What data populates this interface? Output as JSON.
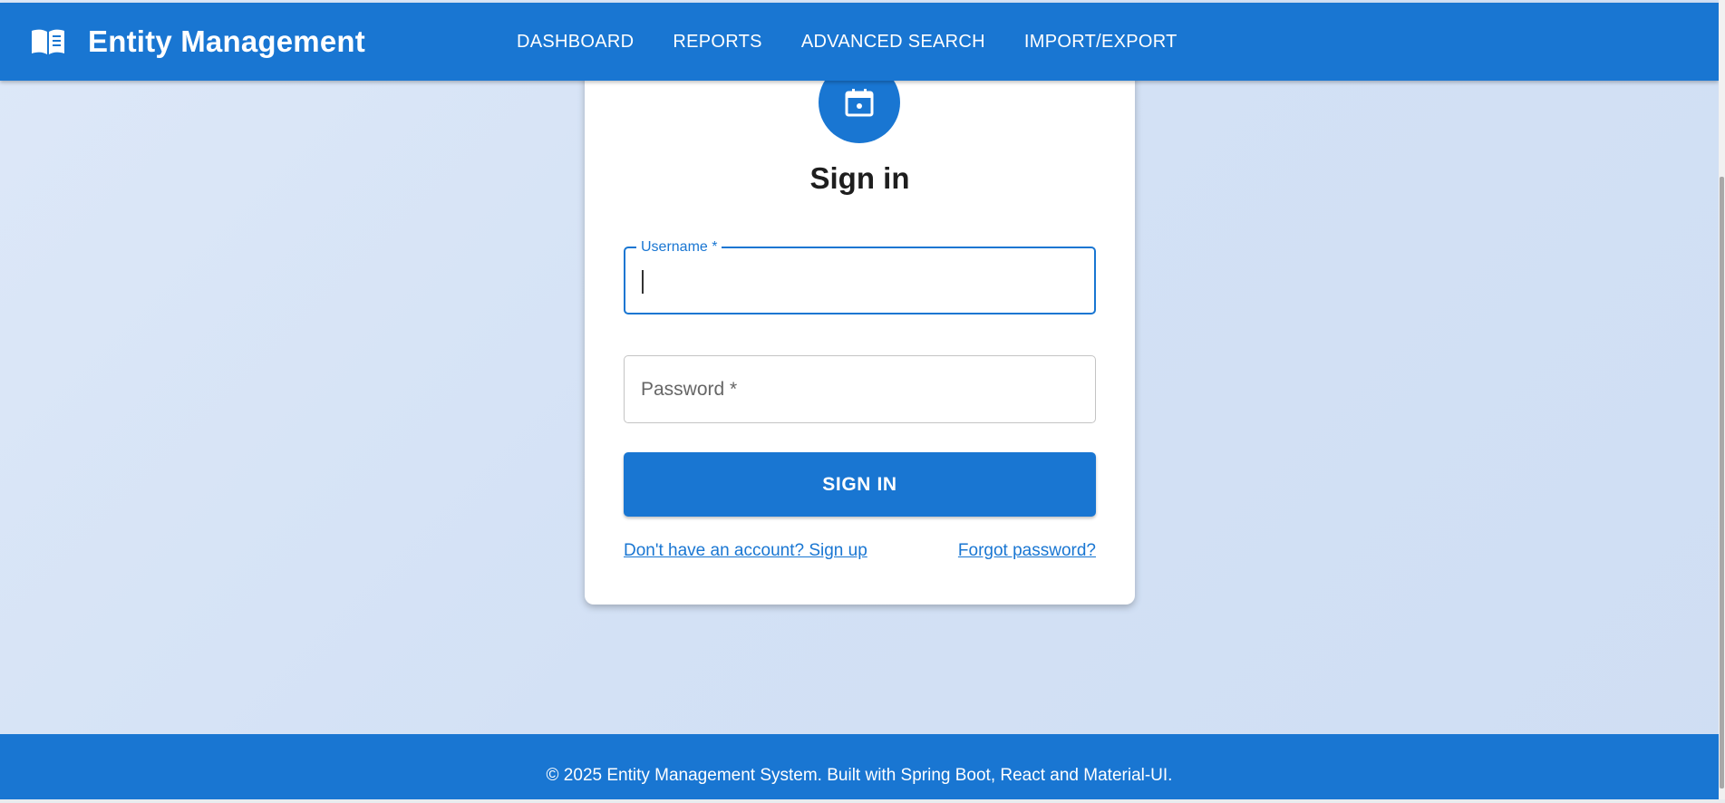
{
  "header": {
    "brand_icon": "book-icon",
    "title": "Entity Management",
    "nav": [
      "DASHBOARD",
      "REPORTS",
      "ADVANCED SEARCH",
      "IMPORT/EXPORT"
    ]
  },
  "login": {
    "avatar_icon": "calendar-icon",
    "title": "Sign in",
    "username_label": "Username *",
    "password_placeholder": "Password *",
    "submit_label": "SIGN IN",
    "signup_link": "Don't have an account? Sign up",
    "forgot_link": "Forgot password?"
  },
  "footer": {
    "text": "© 2025 Entity Management System. Built with Spring Boot, React and Material-UI."
  },
  "colors": {
    "primary": "#1976d2",
    "background": "#d3e1f5"
  }
}
